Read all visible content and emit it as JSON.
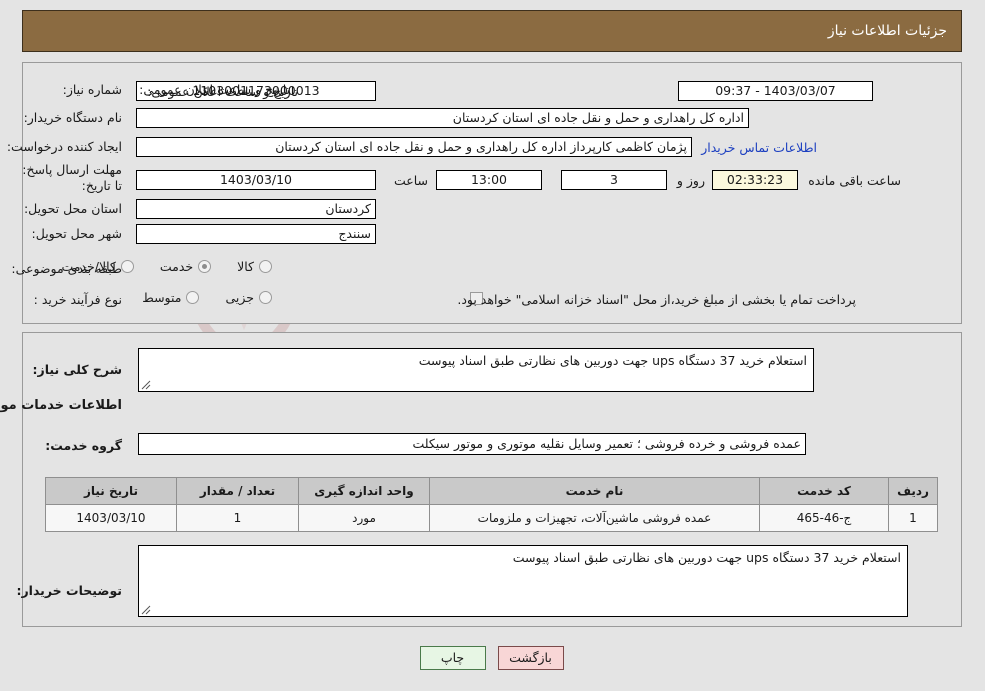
{
  "header": {
    "title": "جزئیات اطلاعات نیاز"
  },
  "top_panel": {
    "need_number_label": "شماره نیاز:",
    "need_number_value": "1103001173000013",
    "public_announce_label": "تاریخ و ساعت اعلان عمومی:",
    "public_announce_value": "1403/03/07 - 09:37",
    "buyer_org_label": "نام دستگاه خریدار:",
    "buyer_org_value": "اداره کل راهداری و حمل و نقل جاده ای استان کردستان",
    "requester_label": "ایجاد کننده درخواست:",
    "requester_value": "پژمان کاظمی کارپرداز اداره کل راهداری و حمل و نقل جاده ای استان کردستان",
    "buyer_contact_link": "اطلاعات تماس خریدار",
    "deadline_label": "مهلت ارسال پاسخ: تا تاریخ:",
    "deadline_date": "1403/03/10",
    "deadline_time_label": "ساعت",
    "deadline_time": "13:00",
    "days_value": "3",
    "days_label": "روز و",
    "countdown_value": "02:33:23",
    "countdown_label": "ساعت باقی مانده",
    "province_label": "استان محل تحویل:",
    "province_value": "کردستان",
    "city_label": "شهر محل تحویل:",
    "city_value": "سنندج",
    "category_label": "طبقه بندی موضوعی:",
    "category_options": [
      {
        "label": "کالا",
        "selected": false
      },
      {
        "label": "خدمت",
        "selected": true
      },
      {
        "label": "کالا/خدمت",
        "selected": false
      }
    ],
    "process_label": "نوع فرآیند خرید :",
    "process_options": [
      {
        "label": "جزیی",
        "selected": false
      },
      {
        "label": "متوسط",
        "selected": false
      }
    ],
    "treasury_checkbox_checked": false,
    "treasury_note": "پرداخت تمام یا بخشی از مبلغ خرید،از محل \"اسناد خزانه اسلامی\" خواهد بود."
  },
  "bottom_panel": {
    "summary_label": "شرح کلی نیاز:",
    "summary_value": "استعلام خرید 37 دستگاه ups جهت دوربین های نظارتی طبق اسناد پیوست",
    "services_heading": "اطلاعات خدمات مورد نیاز",
    "service_group_label": "گروه خدمت:",
    "service_group_value": "عمده فروشی و خرده فروشی ؛ تعمیر وسایل نقلیه موتوری و موتور سیکلت",
    "buyer_notes_label": "توضیحات خریدار:",
    "buyer_notes_value": "استعلام خرید 37 دستگاه ups جهت دوربین های نظارتی طبق اسناد پیوست"
  },
  "items_table": {
    "columns": [
      "ردیف",
      "کد خدمت",
      "نام خدمت",
      "واحد اندازه گیری",
      "تعداد / مقدار",
      "تاریخ نیاز"
    ],
    "rows": [
      {
        "index": "1",
        "code": "ج-46-465",
        "name": "عمده فروشی ماشین‌آلات، تجهیزات و ملزومات",
        "unit": "مورد",
        "quantity": "1",
        "need_date": "1403/03/10"
      }
    ]
  },
  "footer": {
    "back_label": "بازگشت",
    "print_label": "چاپ"
  },
  "watermark": {
    "text": "ArtaTender.net"
  },
  "colors": {
    "header_bg": "#8b6b41",
    "page_bg": "#e4e4e4",
    "link": "#1c3fc0",
    "countdown_bg": "#fbf8dd",
    "back_btn_bg": "#f8d6d6",
    "print_btn_bg": "#e7f6e4"
  }
}
